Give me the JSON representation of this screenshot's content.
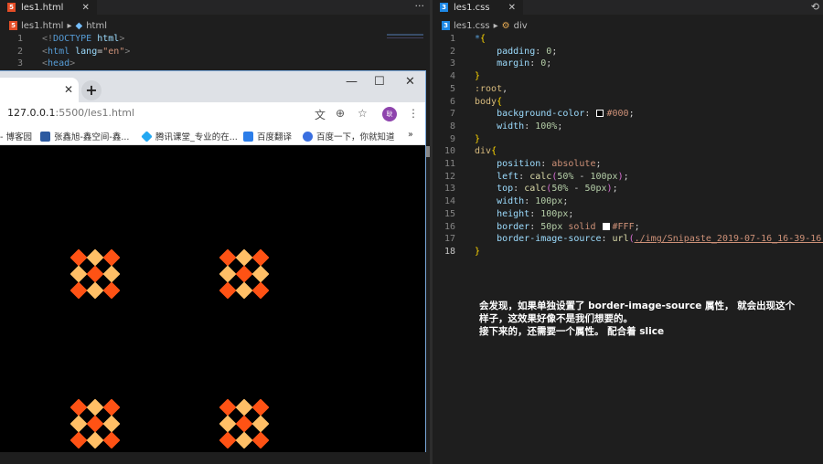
{
  "left_editor": {
    "tab_label": "les1.html",
    "breadcrumb": [
      "les1.html",
      "html"
    ],
    "lines": [
      {
        "n": "1",
        "tokens": [
          [
            "<!",
            "t-punc"
          ],
          [
            "DOCTYPE",
            "t-tag"
          ],
          [
            " html",
            "t-attr"
          ],
          [
            ">",
            "t-punc"
          ]
        ]
      },
      {
        "n": "2",
        "tokens": [
          [
            "<",
            "t-punc"
          ],
          [
            "html",
            "t-tag"
          ],
          [
            " lang",
            "t-attr"
          ],
          [
            "=",
            "t-plain"
          ],
          [
            "\"en\"",
            "t-str"
          ],
          [
            ">",
            "t-punc"
          ]
        ]
      },
      {
        "n": "3",
        "tokens": [
          [
            "<",
            "t-punc"
          ],
          [
            "head",
            "t-tag"
          ],
          [
            ">",
            "t-punc"
          ]
        ]
      }
    ]
  },
  "browser": {
    "url_host": "127.0.0.1",
    "url_rest": ":5500/les1.html",
    "avatar_text": "耿",
    "bookmarks": [
      "- 博客园",
      "张鑫旭-鑫空间-鑫...",
      "腾讯课堂_专业的在...",
      "百度翻译",
      "百度一下，你就知道"
    ],
    "more": "»",
    "pattern_colors": {
      "dark": "#ff5214",
      "light": "#ffbf66"
    }
  },
  "right_editor": {
    "tab_label": "les1.css",
    "breadcrumb": [
      "les1.css",
      "div"
    ],
    "current_line": "18",
    "lines": [
      {
        "n": "1",
        "tokens": [
          [
            "*",
            "t-tag"
          ],
          [
            "{",
            "t-br"
          ]
        ]
      },
      {
        "n": "2",
        "tokens": [
          [
            "    padding",
            "t-prop"
          ],
          [
            ": ",
            "t-plain"
          ],
          [
            "0",
            "t-num"
          ],
          [
            ";",
            "t-plain"
          ]
        ]
      },
      {
        "n": "3",
        "tokens": [
          [
            "    margin",
            "t-prop"
          ],
          [
            ": ",
            "t-plain"
          ],
          [
            "0",
            "t-num"
          ],
          [
            ";",
            "t-plain"
          ]
        ]
      },
      {
        "n": "4",
        "tokens": [
          [
            "}",
            "t-br"
          ]
        ]
      },
      {
        "n": "5",
        "tokens": [
          [
            ":root",
            "t-sel"
          ],
          [
            ",",
            "t-plain"
          ]
        ]
      },
      {
        "n": "6",
        "tokens": [
          [
            "body",
            "t-sel"
          ],
          [
            "{",
            "t-br"
          ]
        ]
      },
      {
        "n": "7",
        "tokens": [
          [
            "    background-color",
            "t-prop"
          ],
          [
            ": ",
            "t-plain"
          ],
          [
            "SW:#000",
            ""
          ],
          [
            "#000",
            "t-val"
          ],
          [
            ";",
            "t-plain"
          ]
        ]
      },
      {
        "n": "8",
        "tokens": [
          [
            "    width",
            "t-prop"
          ],
          [
            ": ",
            "t-plain"
          ],
          [
            "100%",
            "t-num"
          ],
          [
            ";",
            "t-plain"
          ]
        ]
      },
      {
        "n": "9",
        "tokens": [
          [
            "}",
            "t-br"
          ]
        ]
      },
      {
        "n": "10",
        "tokens": [
          [
            "div",
            "t-sel"
          ],
          [
            "{",
            "t-br"
          ]
        ]
      },
      {
        "n": "11",
        "tokens": [
          [
            "    position",
            "t-prop"
          ],
          [
            ": ",
            "t-plain"
          ],
          [
            "absolute",
            "t-val"
          ],
          [
            ";",
            "t-plain"
          ]
        ]
      },
      {
        "n": "12",
        "tokens": [
          [
            "    left",
            "t-prop"
          ],
          [
            ": ",
            "t-plain"
          ],
          [
            "calc",
            "t-fn"
          ],
          [
            "(",
            "t-par"
          ],
          [
            "50%",
            "t-num"
          ],
          [
            " - ",
            "t-plain"
          ],
          [
            "100px",
            "t-num"
          ],
          [
            ")",
            "t-par"
          ],
          [
            ";",
            "t-plain"
          ]
        ]
      },
      {
        "n": "13",
        "tokens": [
          [
            "    top",
            "t-prop"
          ],
          [
            ": ",
            "t-plain"
          ],
          [
            "calc",
            "t-fn"
          ],
          [
            "(",
            "t-par"
          ],
          [
            "50%",
            "t-num"
          ],
          [
            " - ",
            "t-plain"
          ],
          [
            "50px",
            "t-num"
          ],
          [
            ")",
            "t-par"
          ],
          [
            ";",
            "t-plain"
          ]
        ]
      },
      {
        "n": "14",
        "tokens": [
          [
            "    width",
            "t-prop"
          ],
          [
            ": ",
            "t-plain"
          ],
          [
            "100px",
            "t-num"
          ],
          [
            ";",
            "t-plain"
          ]
        ]
      },
      {
        "n": "15",
        "tokens": [
          [
            "    height",
            "t-prop"
          ],
          [
            ": ",
            "t-plain"
          ],
          [
            "100px",
            "t-num"
          ],
          [
            ";",
            "t-plain"
          ]
        ]
      },
      {
        "n": "16",
        "tokens": [
          [
            "    border",
            "t-prop"
          ],
          [
            ": ",
            "t-plain"
          ],
          [
            "50px",
            "t-num"
          ],
          [
            " solid ",
            "t-val"
          ],
          [
            "SW:#FFF",
            ""
          ],
          [
            "#FFF",
            "t-val"
          ],
          [
            ";",
            "t-plain"
          ]
        ]
      },
      {
        "n": "17",
        "tokens": [
          [
            "    border-image-source",
            "t-prop"
          ],
          [
            ": ",
            "t-plain"
          ],
          [
            "url",
            "t-fn"
          ],
          [
            "(",
            "t-par"
          ],
          [
            "./img/Snipaste_2019-07-16_16-39-16.png",
            "t-url"
          ],
          [
            ")",
            "t-par"
          ]
        ]
      },
      {
        "n": "18",
        "tokens": [
          [
            "}",
            "t-br"
          ]
        ]
      }
    ]
  },
  "note": {
    "lines": [
      "会发现，如果单独设置了 border-image-source 属性， 就会出现这个",
      "样子，这效果好像不是我们想要的。",
      "接下来的，还需要一个属性。 配合着 slice"
    ]
  }
}
